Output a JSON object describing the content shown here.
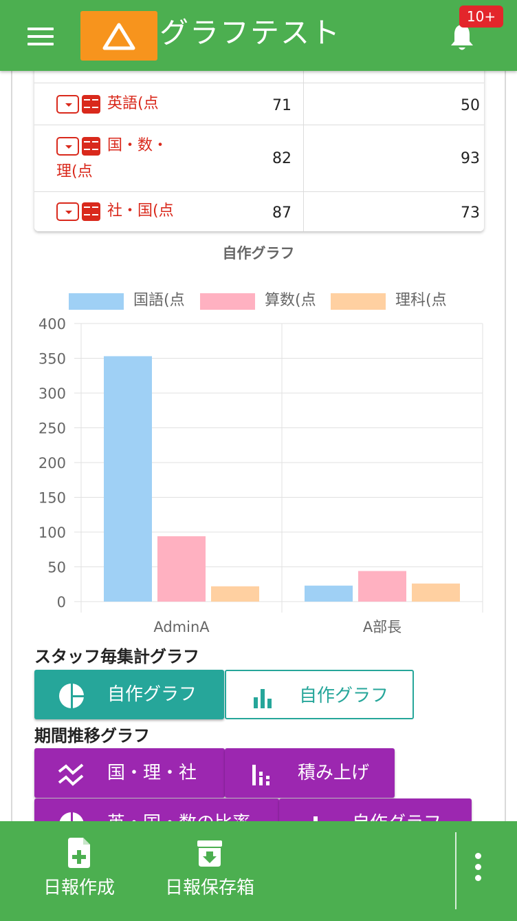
{
  "header": {
    "title": "グラフテスト",
    "notification_count": "10+"
  },
  "table": {
    "rows": [
      {
        "label": "英語(点",
        "value1": "71",
        "value2": "50"
      },
      {
        "label": "国・数・理(点",
        "label_line1": "国・数・",
        "label_line2": "理(点",
        "value1": "82",
        "value2": "93"
      },
      {
        "label": "社・国(点",
        "value1": "87",
        "value2": "73"
      }
    ]
  },
  "chart_data": {
    "type": "bar",
    "title": "自作グラフ",
    "categories": [
      "AdminA",
      "A部長"
    ],
    "series": [
      {
        "name": "国語(点",
        "values": [
          353,
          23
        ],
        "color": "#9fd0f5"
      },
      {
        "name": "算数(点",
        "values": [
          94,
          44
        ],
        "color": "#ffb1c1"
      },
      {
        "name": "理科(点",
        "values": [
          22,
          26
        ],
        "color": "#ffd0a1"
      }
    ],
    "ylim": [
      0,
      400
    ],
    "yticks": [
      "400",
      "350",
      "300",
      "250",
      "200",
      "150",
      "100",
      "50",
      "0"
    ],
    "grid": true,
    "legend": "top"
  },
  "staff_section": {
    "title": "スタッフ毎集計グラフ",
    "buttons": [
      {
        "label": "自作グラフ",
        "icon": "pie-chart-icon"
      },
      {
        "label": "自作グラフ",
        "icon": "bar-chart-icon"
      }
    ]
  },
  "period_section": {
    "title": "期間推移グラフ",
    "buttons": [
      {
        "label": "国・理・社",
        "icon": "line-chart-icon"
      },
      {
        "label": "積み上げ",
        "icon": "stacked-bar-icon"
      },
      {
        "label": "英・国・数の比率",
        "icon": "pie-chart-icon"
      },
      {
        "label": "自作グラフ",
        "icon": "bar-chart-icon"
      }
    ]
  },
  "bottom_nav": {
    "items": [
      {
        "label": "日報作成",
        "icon": "file-add-icon"
      },
      {
        "label": "日報保存箱",
        "icon": "archive-download-icon"
      }
    ]
  },
  "colors": {
    "primary": "#4caf50",
    "accent": "#f7941d",
    "teal": "#26a69a",
    "purple": "#9c27b0",
    "subject_red": "#d9291c"
  }
}
